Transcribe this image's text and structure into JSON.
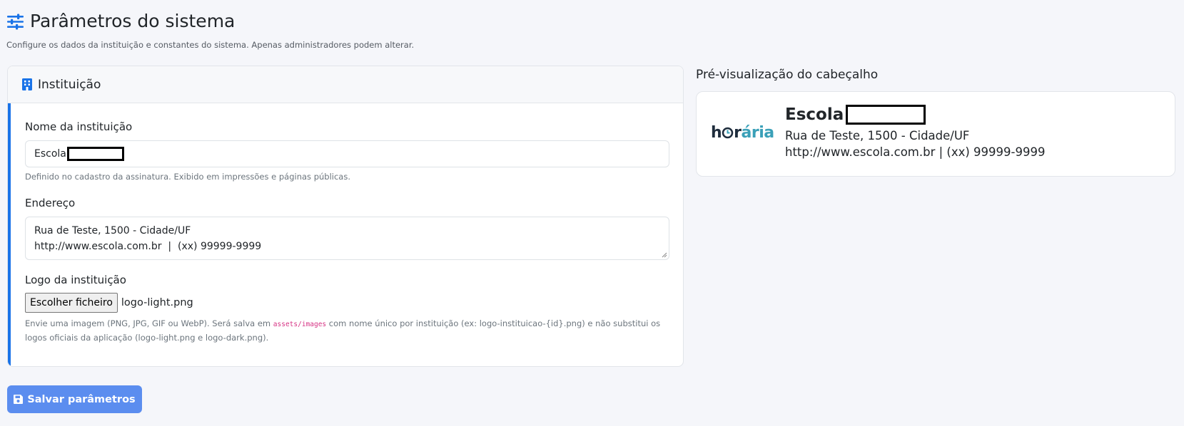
{
  "page": {
    "title": "Parâmetros do sistema",
    "subtitle": "Configure os dados da instituição e constantes do sistema. Apenas administradores podem alterar."
  },
  "card": {
    "header": "Instituição",
    "name_label": "Nome da instituição",
    "name_value": "Escola",
    "name_help": "Definido no cadastro da assinatura. Exibido em impressões e páginas públicas.",
    "address_label": "Endereço",
    "address_line1": "Rua de Teste, 1500 - Cidade/UF",
    "address_line2": "http://www.escola.com.br  |  (xx) 99999-9999",
    "logo_label": "Logo da instituição",
    "file_button": "Escolher ficheiro",
    "file_name": "logo-light.png",
    "logo_help_pre": "Envie uma imagem (PNG, JPG, GIF ou WebP). Será salva em ",
    "logo_help_code": "assets/images",
    "logo_help_post": " com nome único por instituição (ex: logo-instituicao-{id}.png) e não substitui os logos oficiais da aplicação (logo-light.png e logo-dark.png)."
  },
  "save_button": "Salvar parâmetros",
  "preview": {
    "title": "Pré-visualização do cabeçalho",
    "logo_text_1": "h",
    "logo_text_2": "r",
    "logo_text_3": "ária",
    "name": "Escola",
    "line1": "Rua de Teste, 1500 - Cidade/UF",
    "line2": "http://www.escola.com.br | (xx) 99999-9999"
  },
  "colors": {
    "accent": "#1a73e8",
    "button": "#5b8def",
    "background": "#f5f6fa"
  },
  "icons": {
    "title": "sliders-icon",
    "card": "building-icon",
    "save": "floppy-disk-icon"
  }
}
